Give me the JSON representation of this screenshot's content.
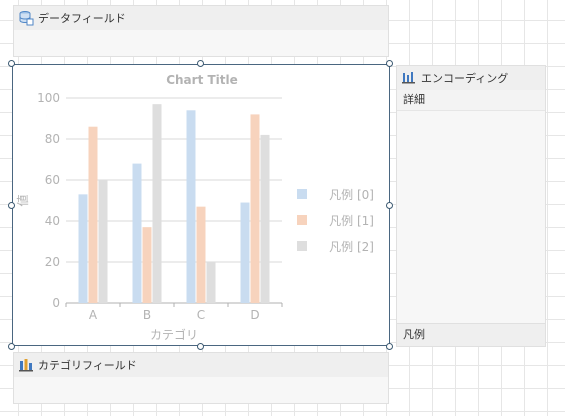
{
  "data_field_zone": {
    "label": "データフィールド"
  },
  "category_field_zone": {
    "label": "カテゴリフィールド"
  },
  "encoding_panel": {
    "label": "エンコーディング",
    "detail_label": "詳細",
    "legend_label": "凡例"
  },
  "chart_data": {
    "type": "bar",
    "title": "Chart Title",
    "xlabel": "カテゴリ",
    "ylabel": "値",
    "categories": [
      "A",
      "B",
      "C",
      "D"
    ],
    "ylim": [
      0,
      100
    ],
    "yticks": [
      0,
      20,
      40,
      60,
      80,
      100
    ],
    "grid": true,
    "legend_position": "right",
    "series": [
      {
        "name": "凡例 [0]",
        "color": "#c9dcf0",
        "values": [
          53,
          68,
          94,
          49
        ]
      },
      {
        "name": "凡例 [1]",
        "color": "#f7d3bd",
        "values": [
          86,
          37,
          47,
          92
        ]
      },
      {
        "name": "凡例 [2]",
        "color": "#dedede",
        "values": [
          60,
          97,
          20,
          82
        ]
      }
    ]
  }
}
